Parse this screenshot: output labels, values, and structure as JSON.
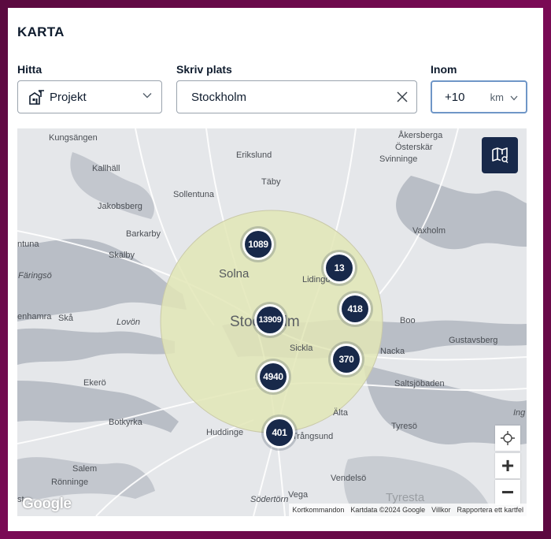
{
  "card": {
    "title": "KARTA"
  },
  "find": {
    "label": "Hitta",
    "value": "Projekt",
    "icon": "building-crane-icon"
  },
  "place": {
    "label": "Skriv plats",
    "value": "Stockholm"
  },
  "radius": {
    "label": "Inom",
    "value": "+10",
    "unit": "km"
  },
  "map": {
    "places": [
      {
        "name": "Kungsängen",
        "cls": ""
      },
      {
        "name": "Erikslund",
        "cls": ""
      },
      {
        "name": "Åkersberga",
        "cls": ""
      },
      {
        "name": "Österskär",
        "cls": ""
      },
      {
        "name": "Svinninge",
        "cls": ""
      },
      {
        "name": "Kallhäll",
        "cls": ""
      },
      {
        "name": "Täby",
        "cls": ""
      },
      {
        "name": "Sollentuna",
        "cls": ""
      },
      {
        "name": "Jakobsberg",
        "cls": ""
      },
      {
        "name": "Barkarby",
        "cls": ""
      },
      {
        "name": "Vaxholm",
        "cls": ""
      },
      {
        "name": "ntuna",
        "cls": ""
      },
      {
        "name": "Skälby",
        "cls": ""
      },
      {
        "name": "Färingsö",
        "cls": "it"
      },
      {
        "name": "Solna",
        "cls": "mid"
      },
      {
        "name": "Lidingö",
        "cls": ""
      },
      {
        "name": "enhamra",
        "cls": ""
      },
      {
        "name": "Skå",
        "cls": ""
      },
      {
        "name": "Lovön",
        "cls": "it"
      },
      {
        "name": "Stockholm",
        "cls": "big"
      },
      {
        "name": "Boo",
        "cls": ""
      },
      {
        "name": "Sickla",
        "cls": ""
      },
      {
        "name": "Nacka",
        "cls": ""
      },
      {
        "name": "Gustavsberg",
        "cls": ""
      },
      {
        "name": "Ekerö",
        "cls": ""
      },
      {
        "name": "Saltsjöbaden",
        "cls": ""
      },
      {
        "name": "Älta",
        "cls": ""
      },
      {
        "name": "Ing",
        "cls": "it"
      },
      {
        "name": "Botkyrka",
        "cls": ""
      },
      {
        "name": "Huddinge",
        "cls": ""
      },
      {
        "name": "Trångsund",
        "cls": ""
      },
      {
        "name": "Tyresö",
        "cls": ""
      },
      {
        "name": "Salem",
        "cls": ""
      },
      {
        "name": "Rönninge",
        "cls": ""
      },
      {
        "name": "Vendelsö",
        "cls": ""
      },
      {
        "name": "st",
        "cls": ""
      },
      {
        "name": "Södertörn",
        "cls": "it"
      },
      {
        "name": "Vega",
        "cls": ""
      },
      {
        "name": "Tyresta",
        "cls": "mid"
      }
    ],
    "clusters": [
      "1089",
      "13",
      "13909",
      "418",
      "370",
      "4940",
      "401"
    ],
    "controls": {
      "layers": "map-layers-icon",
      "locate": "locate-icon",
      "zoom_in": "+",
      "zoom_out": "−"
    },
    "google": "Google",
    "attribution": {
      "shortcuts": "Kortkommandon",
      "data": "Kartdata ©2024 Google",
      "terms": "Villkor",
      "report": "Rapportera ett kartfel"
    },
    "colors": {
      "cluster": "#18294a",
      "radius_fill": "#e2e6b6",
      "water": "#b9bec6",
      "land": "#e5e7ea"
    }
  }
}
